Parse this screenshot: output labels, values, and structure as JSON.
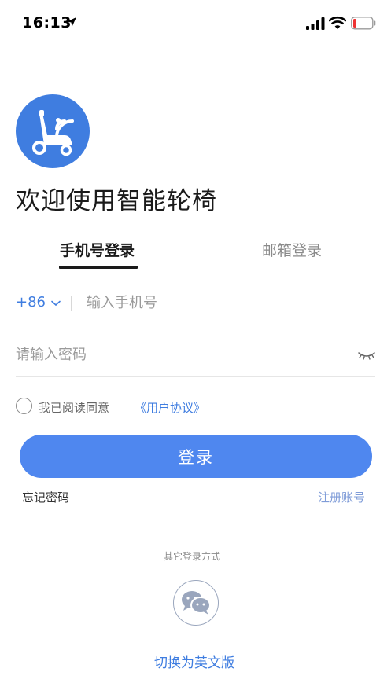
{
  "status_bar": {
    "time": "16:13"
  },
  "app": {
    "welcome_title": "欢迎使用智能轮椅",
    "logo_icon": "wheelchair-wifi-icon",
    "accent_color": "#3f7de0"
  },
  "tabs": [
    {
      "label": "手机号登录",
      "active": true
    },
    {
      "label": "邮箱登录",
      "active": false
    }
  ],
  "form": {
    "country_code": "+86",
    "phone_placeholder": "输入手机号",
    "password_placeholder": "请输入密码",
    "agree_text": "我已阅读同意",
    "agree_link": "《用户协议》",
    "login_label": "登录",
    "forgot_label": "忘记密码",
    "register_label": "注册账号"
  },
  "other_login": {
    "label": "其它登录方式",
    "icon": "wechat-icon"
  },
  "footer": {
    "switch_language_label": "切换为英文版"
  }
}
